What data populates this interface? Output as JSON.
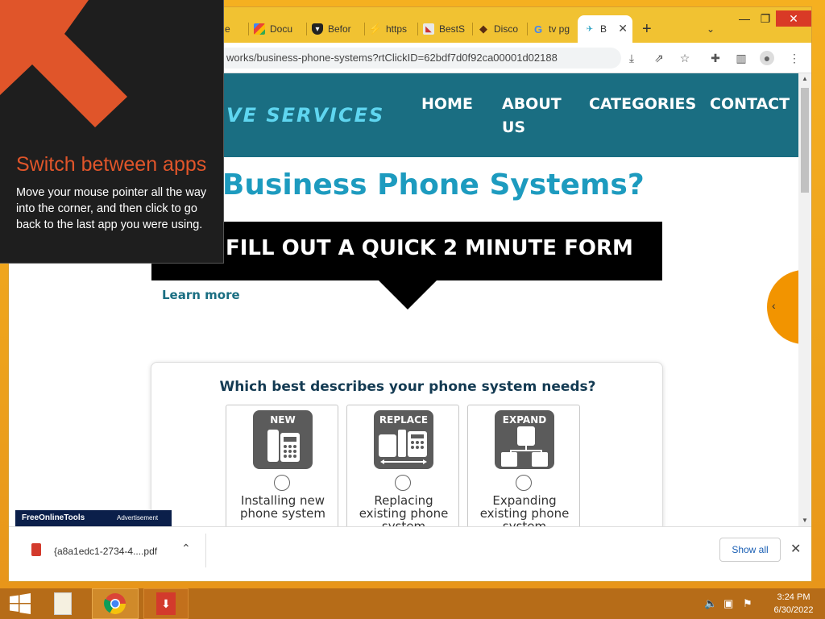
{
  "browser": {
    "tabs": [
      {
        "label": "e",
        "fav": "doc"
      },
      {
        "label": "Docu",
        "fav": "google-docs"
      },
      {
        "label": "Befor",
        "fav": "shield"
      },
      {
        "label": "https",
        "fav": "bolt"
      },
      {
        "label": "BestS",
        "fav": "site"
      },
      {
        "label": "Disco",
        "fav": "diamond"
      },
      {
        "label": "tv pg",
        "fav": "google"
      },
      {
        "label": "B",
        "fav": "active-site"
      }
    ],
    "new_tab": "+",
    "url": "works/business-phone-systems?rtClickID=62bdf7d0f92ca00001d02188"
  },
  "site": {
    "logo_text": "VE SERVICES",
    "nav": {
      "home": "HOME",
      "about_line1": "ABOUT",
      "about_line2": "US",
      "categories": "CATEGORIES",
      "contact": "CONTACT"
    },
    "headline": "l Business Phone Systems?",
    "form_banner": "FILL OUT A QUICK 2 MINUTE FORM",
    "learn_more": "Learn more",
    "question": "Which best describes your phone system needs?",
    "options": [
      {
        "tag": "NEW",
        "line1": "Installing new",
        "line2": "phone system",
        "line3": ""
      },
      {
        "tag": "REPLACE",
        "line1": "Replacing",
        "line2": "existing phone",
        "line3": "system"
      },
      {
        "tag": "EXPAND",
        "line1": "Expanding",
        "line2": "existing phone",
        "line3": "system"
      }
    ],
    "ad_brand": "FreeOnlineTools",
    "ad_label": "Advertisement"
  },
  "downloads": {
    "filename": "{a8a1edc1-2734-4....pdf",
    "show_all": "Show all"
  },
  "charm": {
    "title": "Switch between apps",
    "body": "Move your mouse pointer all the way into the corner, and then click to go back to the last app you were using."
  },
  "taskbar": {
    "time": "3:24 PM",
    "date": "6/30/2022"
  },
  "colors": {
    "header_bg": "#1a6e82",
    "headline": "#1d9bbf",
    "charm_accent": "#e0552a",
    "desktop": "#f0a020"
  }
}
